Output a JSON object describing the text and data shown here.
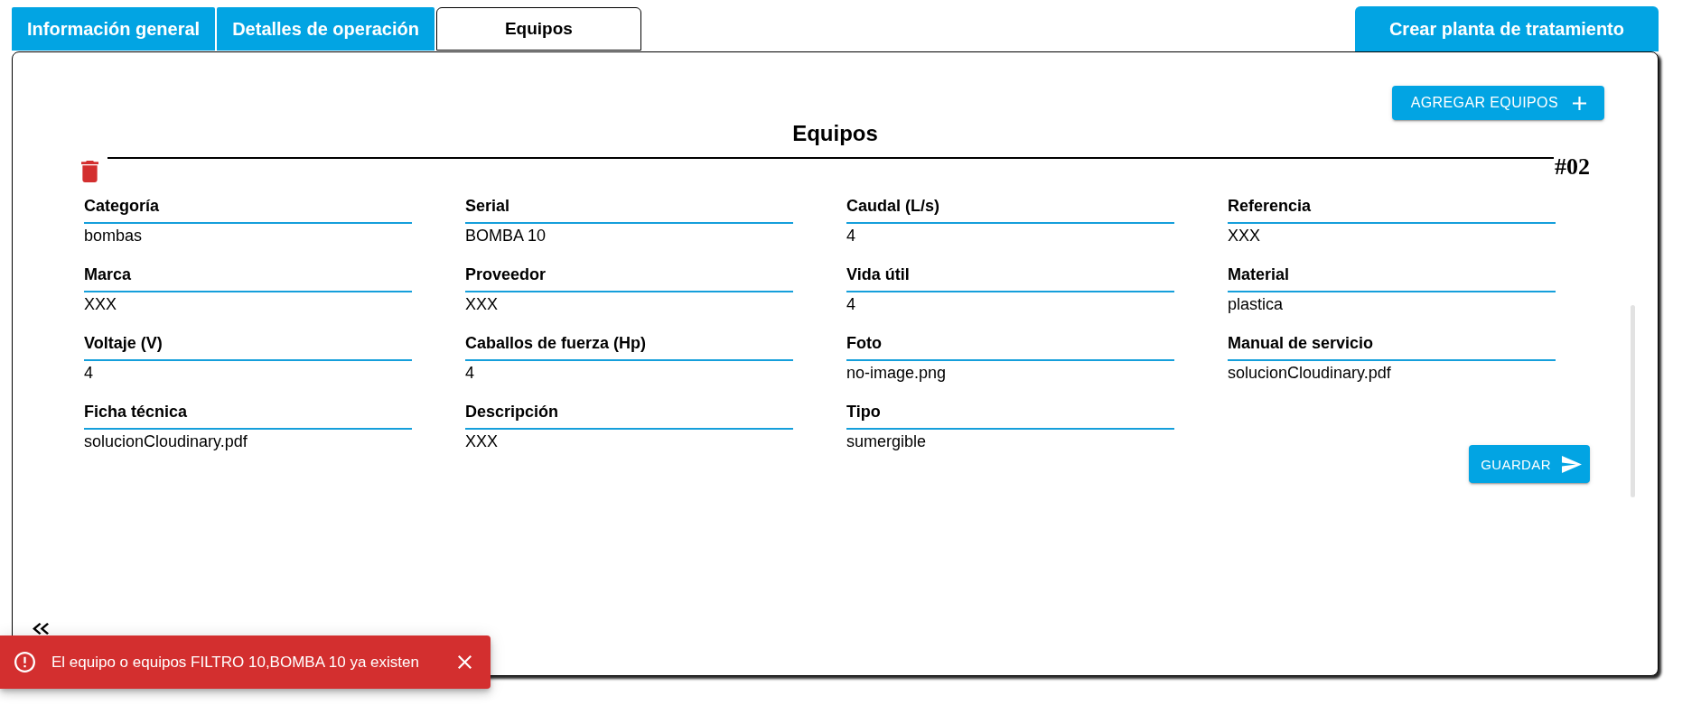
{
  "tabs": [
    {
      "label": "Información general",
      "selected": false
    },
    {
      "label": "Detalles de operación",
      "selected": false
    },
    {
      "label": "Equipos",
      "selected": true
    }
  ],
  "header_button": {
    "label": "Crear planta de tratamiento"
  },
  "panel": {
    "add_button": {
      "label": "AGREGAR EQUIPOS"
    },
    "title": "Equipos",
    "equipment": [
      {
        "number": "#02",
        "fields": [
          {
            "label": "Categoría",
            "value": "bombas"
          },
          {
            "label": "Serial",
            "value": "BOMBA 10"
          },
          {
            "label": "Caudal (L/s)",
            "value": "4"
          },
          {
            "label": "Referencia",
            "value": "XXX"
          },
          {
            "label": "Marca",
            "value": "XXX"
          },
          {
            "label": "Proveedor",
            "value": "XXX"
          },
          {
            "label": "Vida útil",
            "value": "4"
          },
          {
            "label": "Material",
            "value": "plastica"
          },
          {
            "label": "Voltaje (V)",
            "value": "4"
          },
          {
            "label": "Caballos de fuerza (Hp)",
            "value": "4"
          },
          {
            "label": "Foto",
            "value": "no-image.png"
          },
          {
            "label": "Manual de servicio",
            "value": "solucionCloudinary.pdf"
          },
          {
            "label": "Ficha técnica",
            "value": "solucionCloudinary.pdf"
          },
          {
            "label": "Descripción",
            "value": "XXX"
          },
          {
            "label": "Tipo",
            "value": "sumergible"
          }
        ],
        "save_button": {
          "label": "GUARDAR"
        }
      }
    ]
  },
  "snackbar": {
    "message": "El equipo o equipos FILTRO 10,BOMBA 10 ya existen"
  }
}
